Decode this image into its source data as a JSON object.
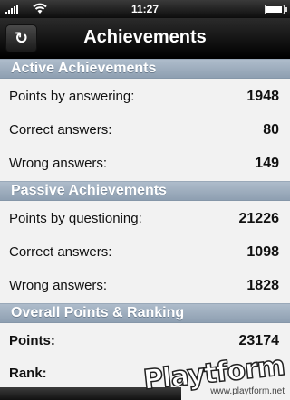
{
  "status": {
    "time": "11:27"
  },
  "nav": {
    "title": "Achievements",
    "refresh_icon": "↻"
  },
  "sections": [
    {
      "header": "Active Achievements",
      "rows": [
        {
          "label": "Points by answering:",
          "value": "1948"
        },
        {
          "label": "Correct answers:",
          "value": "80"
        },
        {
          "label": "Wrong answers:",
          "value": "149"
        }
      ]
    },
    {
      "header": "Passive Achievements",
      "rows": [
        {
          "label": "Points by questioning:",
          "value": "21226"
        },
        {
          "label": "Correct answers:",
          "value": "1098"
        },
        {
          "label": "Wrong answers:",
          "value": "1828"
        }
      ]
    },
    {
      "header": "Overall Points & Ranking",
      "rows": [
        {
          "label": "Points:",
          "value": "23174"
        },
        {
          "label": "Rank:",
          "value": ""
        }
      ]
    }
  ],
  "watermark": {
    "logo": "Playtform",
    "url": "www.playtform.net"
  }
}
